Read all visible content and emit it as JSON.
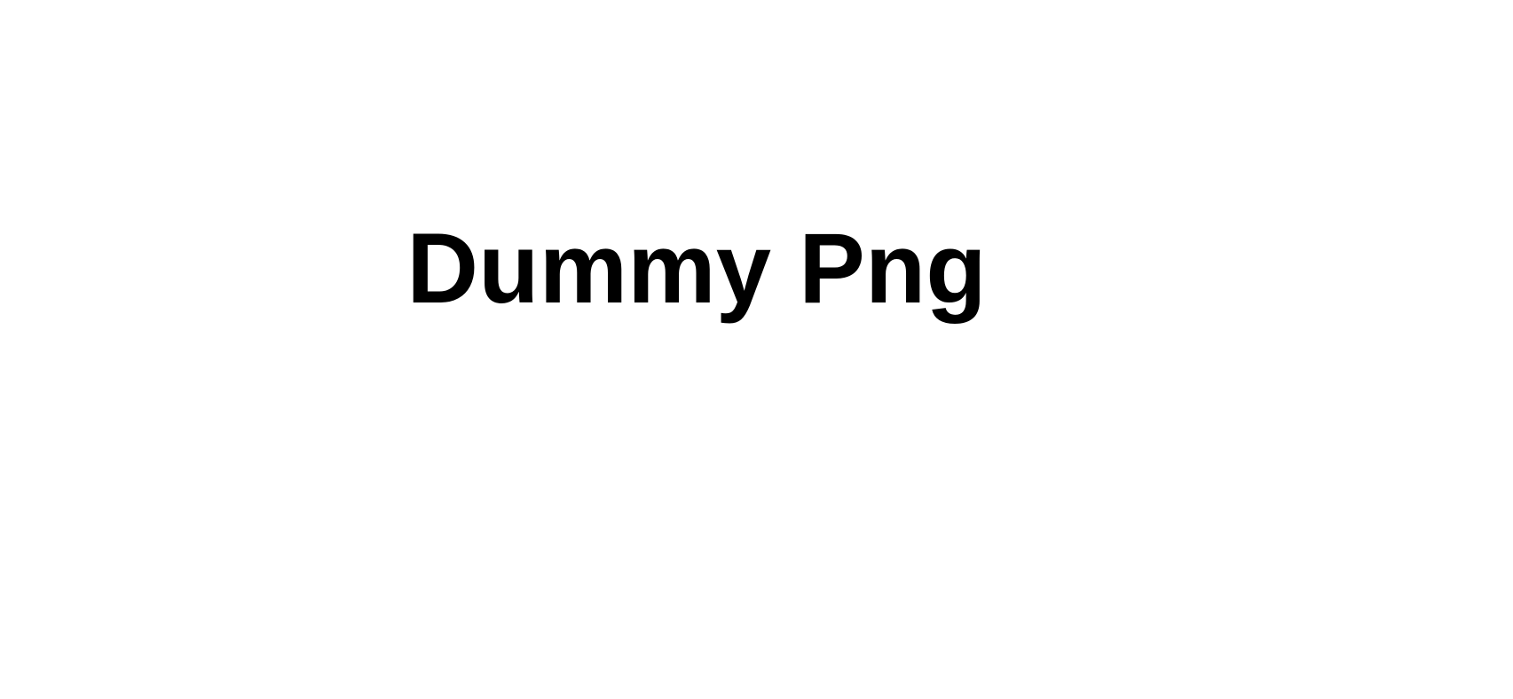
{
  "main": {
    "text": "Dummy Png",
    "text_color": "#000000",
    "background_color": "#ffffff"
  }
}
